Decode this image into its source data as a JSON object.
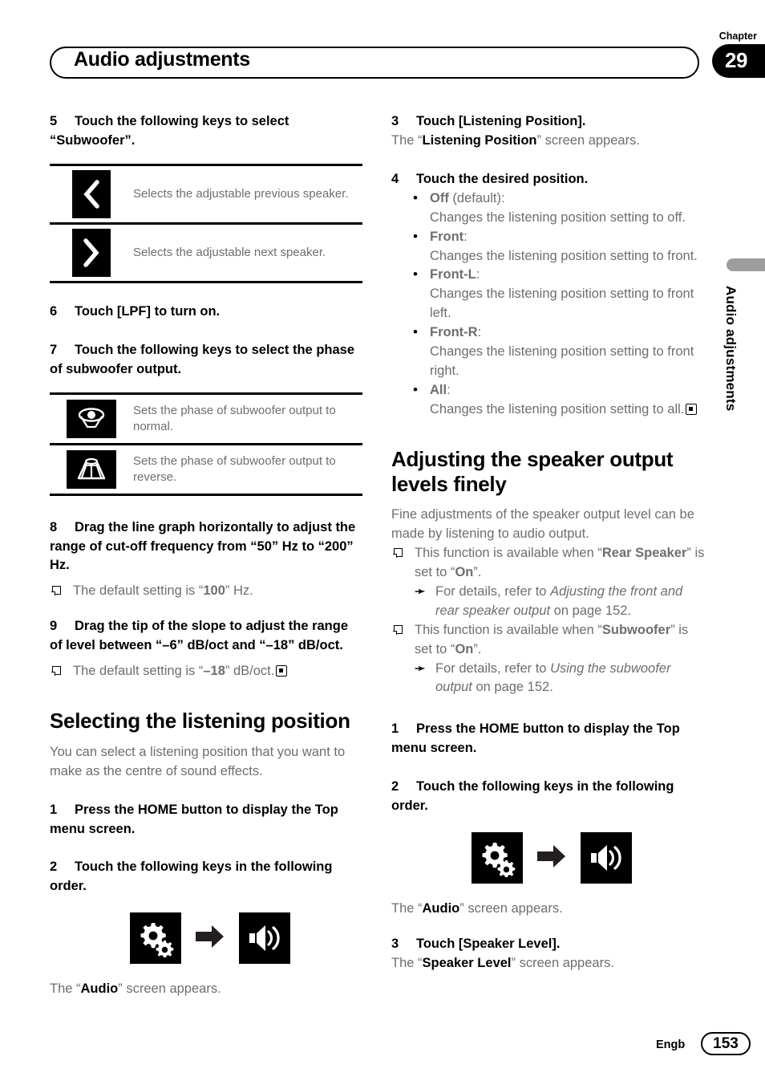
{
  "header": {
    "title": "Audio adjustments",
    "chapter_label": "Chapter",
    "chapter_number": "29"
  },
  "side_tab": {
    "text": "Audio adjustments"
  },
  "footer": {
    "language": "Engb",
    "page_number": "153"
  },
  "left_column": {
    "step5": {
      "num": "5",
      "text": "Touch the following keys to select “Subwoofer”."
    },
    "step5_keys": [
      {
        "icon": "chevron-left-icon",
        "desc": "Selects the adjustable previous speaker."
      },
      {
        "icon": "chevron-right-icon",
        "desc": "Selects the adjustable next speaker."
      }
    ],
    "step6": {
      "num": "6",
      "text": "Touch [LPF] to turn on."
    },
    "step7": {
      "num": "7",
      "text": "Touch the following keys to select the phase of subwoofer output."
    },
    "step7_keys": [
      {
        "icon": "speaker-normal-phase-icon",
        "desc": "Sets the phase of subwoofer output to normal."
      },
      {
        "icon": "speaker-reverse-phase-icon",
        "desc": "Sets the phase of subwoofer output to reverse."
      }
    ],
    "step8": {
      "num": "8",
      "text": "Drag the line graph horizontally to adjust the range of cut-off frequency from “50” Hz to “200” Hz.",
      "note_pre": "The default setting is “",
      "note_bold": "100",
      "note_post": "” Hz."
    },
    "step9": {
      "num": "9",
      "text": "Drag the tip of the slope to adjust the range of level between “–6” dB/oct and “–18” dB/oct.",
      "note_pre": "The default setting is “",
      "note_bold": "–18",
      "note_post": "” dB/oct."
    },
    "section_heading": "Selecting the listening position",
    "section_intro": "You can select a listening position that you want to make as the centre of sound effects.",
    "step1": {
      "num": "1",
      "text": "Press the HOME button to display the Top menu screen."
    },
    "step2": {
      "num": "2",
      "text": "Touch the following keys in the following order."
    },
    "result_pre": "The “",
    "result_bold": "Audio",
    "result_post": "” screen appears."
  },
  "right_column": {
    "step3": {
      "num": "3",
      "text": "Touch [Listening Position].",
      "result_pre": "The “",
      "result_bold": "Listening Position",
      "result_post": "” screen appears."
    },
    "step4": {
      "num": "4",
      "text": "Touch the desired position."
    },
    "step4_options": [
      {
        "name": "Off",
        "suffix": " (default):",
        "desc": "Changes the listening position setting to off."
      },
      {
        "name": "Front",
        "suffix": ":",
        "desc": "Changes the listening position setting to front."
      },
      {
        "name": "Front-L",
        "suffix": ":",
        "desc": "Changes the listening position setting to front left."
      },
      {
        "name": "Front-R",
        "suffix": ":",
        "desc": "Changes the listening position setting to front right."
      },
      {
        "name": "All",
        "suffix": ":",
        "desc": "Changes the listening position setting to all."
      }
    ],
    "section_heading": "Adjusting the speaker output levels finely",
    "section_intro": "Fine adjustments of the speaker output level can be made by listening to audio output.",
    "note1": {
      "pre": "This function is available when “",
      "bold1": "Rear Speaker",
      "mid": "” is set to “",
      "bold2": "On",
      "post": "”."
    },
    "ref1": {
      "pre": "For details, refer to ",
      "italic": "Adjusting the front and rear speaker output",
      "post": " on page 152."
    },
    "note2": {
      "pre": "This function is available when “",
      "bold1": "Subwoofer",
      "mid": "” is set to “",
      "bold2": "On",
      "post": "”."
    },
    "ref2": {
      "pre": "For details, refer to ",
      "italic": "Using the subwoofer output",
      "post": " on page 152."
    },
    "step1": {
      "num": "1",
      "text": "Press the HOME button to display the Top menu screen."
    },
    "step2": {
      "num": "2",
      "text": "Touch the following keys in the following order."
    },
    "result_pre": "The “",
    "result_bold": "Audio",
    "result_post": "” screen appears.",
    "step3b": {
      "num": "3",
      "text": "Touch [Speaker Level].",
      "result_pre": "The “",
      "result_bold": "Speaker Level",
      "result_post": "” screen appears."
    }
  },
  "icons": {
    "gears": "gears-icon",
    "arrow": "arrow-right-icon",
    "speaker": "speaker-volume-icon"
  }
}
